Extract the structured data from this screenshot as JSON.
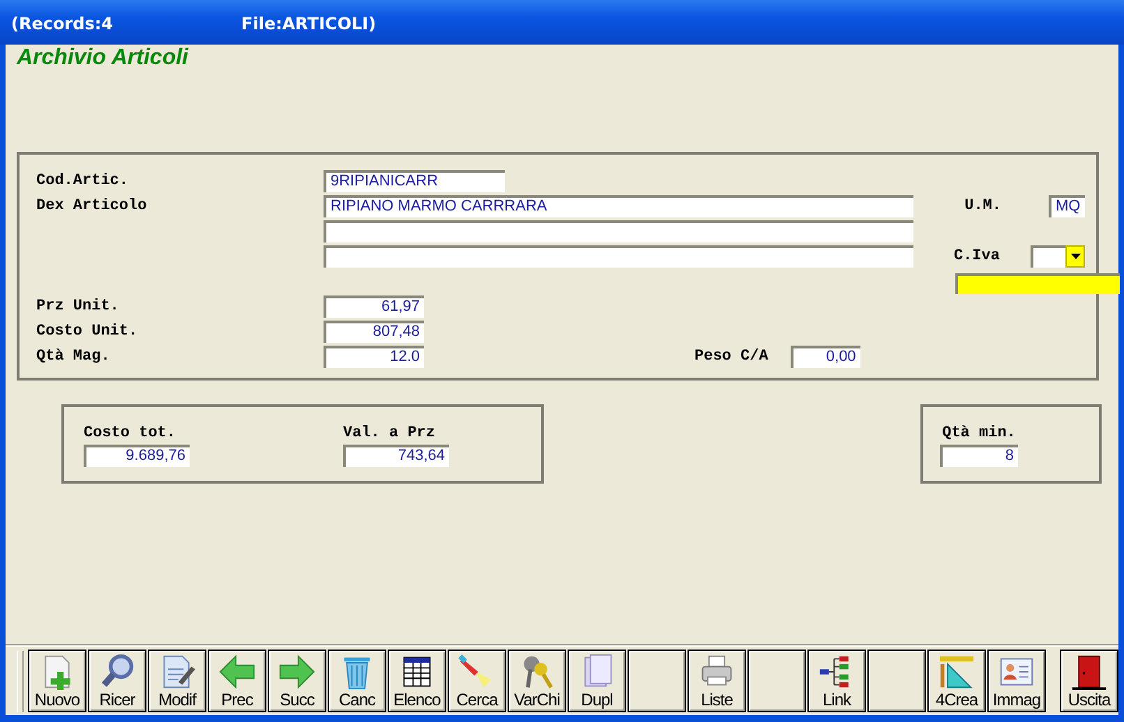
{
  "title_bar": {
    "records": "(Records:4",
    "file": "File:ARTICOLI)"
  },
  "heading": "Archivio Articoli",
  "code": {
    "label": "Cod.Artic.",
    "value": "9RIPIANICARR"
  },
  "description": {
    "label": "Dex Articolo",
    "value": "RIPIANO MARMO CARRRARA"
  },
  "description_extra": [
    {
      "kind": "blank"
    },
    {
      "kind": "blank"
    }
  ],
  "unit": {
    "label": "U.M.",
    "value": "MQ"
  },
  "vat": {
    "label": "C.Iva"
  },
  "prices": [
    {
      "label": "Prz Unit.",
      "value": "61,97"
    },
    {
      "label": "Costo Unit.",
      "value": "807,48"
    },
    {
      "label": "Qtà Mag.",
      "value": "12.0"
    }
  ],
  "weight": {
    "label": "Peso C/A",
    "value": "0,00"
  },
  "totals": [
    {
      "label": "Costo tot.",
      "value": "9.689,76"
    },
    {
      "label": "Val. a Prz",
      "value": "743,64"
    }
  ],
  "min_qty": {
    "label": "Qtà min.",
    "value": "8"
  },
  "toolbar": [
    {
      "kind": "button",
      "label": "Nuovo"
    },
    {
      "kind": "button",
      "label": "Ricer"
    },
    {
      "kind": "button",
      "label": "Modif"
    },
    {
      "kind": "button",
      "label": "Prec"
    },
    {
      "kind": "button",
      "label": "Succ"
    },
    {
      "kind": "button",
      "label": "Canc"
    },
    {
      "kind": "button",
      "label": "Elenco"
    },
    {
      "kind": "button",
      "label": "Cerca"
    },
    {
      "kind": "button",
      "label": "VarChi"
    },
    {
      "kind": "button",
      "label": "Dupl"
    },
    {
      "kind": "empty"
    },
    {
      "kind": "button",
      "label": "Liste"
    },
    {
      "kind": "empty"
    },
    {
      "kind": "button",
      "label": "Link"
    },
    {
      "kind": "empty"
    },
    {
      "kind": "button",
      "label": "4Crea"
    },
    {
      "kind": "button",
      "label": "Immag"
    },
    {
      "kind": "exit",
      "label": "Uscita"
    }
  ]
}
